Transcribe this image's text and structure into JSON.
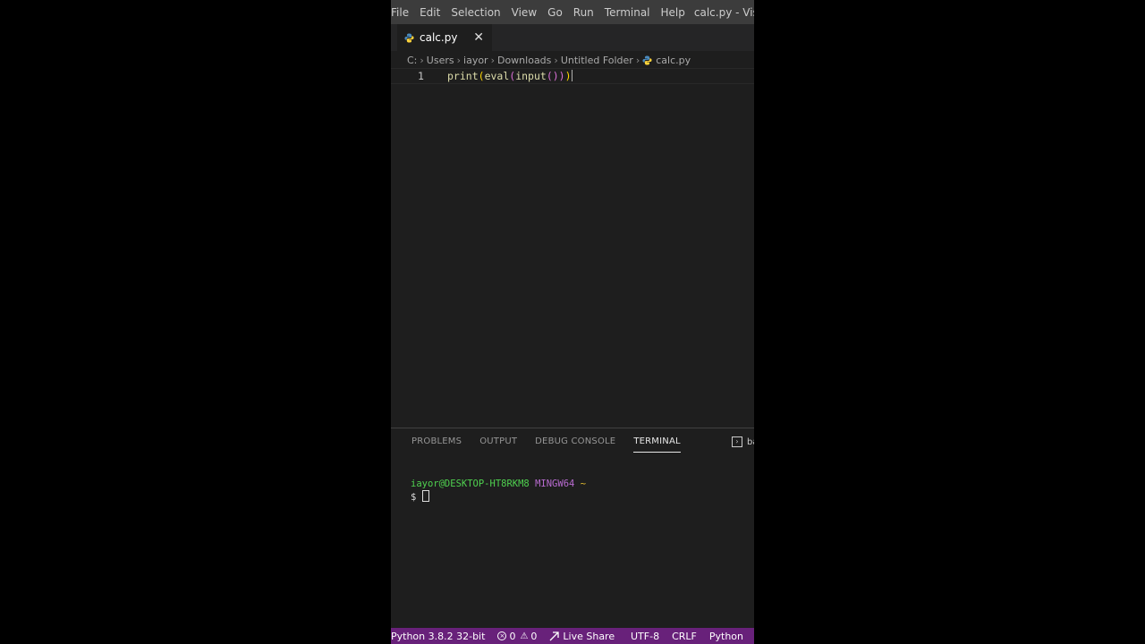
{
  "menu": {
    "items": [
      "File",
      "Edit",
      "Selection",
      "View",
      "Go",
      "Run",
      "Terminal",
      "Help"
    ],
    "window_title": "calc.py - Visual Studi"
  },
  "tab": {
    "label": "calc.py",
    "close_glyph": "✕",
    "icon": "python-icon"
  },
  "breadcrumb": [
    "C:",
    "Users",
    "iayor",
    "Downloads",
    "Untitled Folder",
    "calc.py"
  ],
  "editor": {
    "line_number": "1",
    "code": {
      "fn1": "print",
      "p1": "(",
      "fn2": "eval",
      "p2": "(",
      "fn3": "input",
      "p3": "())",
      "p4": ")"
    }
  },
  "panel": {
    "tabs": [
      "PROBLEMS",
      "OUTPUT",
      "DEBUG CONSOLE",
      "TERMINAL"
    ],
    "active_tab": "TERMINAL",
    "right_label": "ba"
  },
  "terminal": {
    "user": "iayor@DESKTOP-HT8RKM8",
    "system": "MINGW64",
    "dir": "~",
    "prompt": "$"
  },
  "status_bar": {
    "interpreter": "Python 3.8.2 32-bit",
    "errors": "0",
    "warnings": "0",
    "live_share": "Live Share",
    "encoding": "UTF-8",
    "eol": "CRLF",
    "language": "Python",
    "color": "#68217a"
  }
}
